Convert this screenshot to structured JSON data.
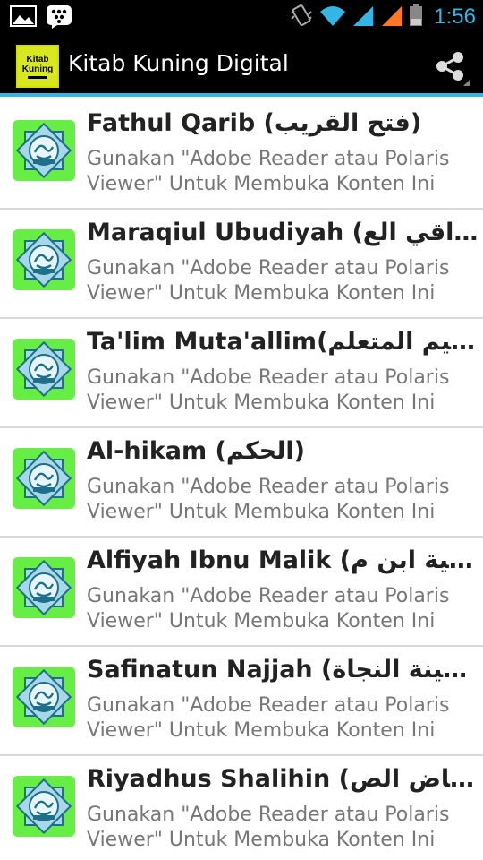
{
  "status_bar": {
    "time": "1:56",
    "icons": [
      "image-icon",
      "bbm-icon",
      "vibrate-icon",
      "wifi-icon",
      "signal-icon",
      "signal-icon",
      "battery-icon"
    ]
  },
  "action_bar": {
    "logo_line1": "Kitab",
    "logo_line2": "Kuning",
    "title": "Kitab Kuning Digital",
    "share_icon": "share-icon",
    "accent": "#33b5e5"
  },
  "list": {
    "subtitle": "Gunakan \"Adobe Reader atau Polaris Viewer\" Untuk Membuka Konten Ini",
    "icon_color": "#66ee44",
    "items": [
      {
        "title": "Fathul Qarib (فتح القريب)",
        "subtitle": "Gunakan \"Adobe Reader atau Polaris Viewer\" Untuk Membuka Konten Ini"
      },
      {
        "title": "Maraqiul Ubudiyah (مراقي الع...",
        "subtitle": "Gunakan \"Adobe Reader atau Polaris Viewer\" Untuk Membuka Konten Ini"
      },
      {
        "title": "Ta'lim Muta'allim(تعليم المتعلم)",
        "subtitle": "Gunakan \"Adobe Reader atau Polaris Viewer\" Untuk Membuka Konten Ini"
      },
      {
        "title": "Al-hikam (الحكم)",
        "subtitle": "Gunakan \"Adobe Reader atau Polaris Viewer\" Untuk Membuka Konten Ini"
      },
      {
        "title": "Alfiyah Ibnu Malik (الفية ابن م...",
        "subtitle": "Gunakan \"Adobe Reader atau Polaris Viewer\" Untuk Membuka Konten Ini"
      },
      {
        "title": "Safinatun Najjah (سفينة النجاة)",
        "subtitle": "Gunakan \"Adobe Reader atau Polaris Viewer\" Untuk Membuka Konten Ini"
      },
      {
        "title": "Riyadhus Shalihin (رياض الص...",
        "subtitle": "Gunakan \"Adobe Reader atau Polaris Viewer\" Untuk Membuka Konten Ini"
      }
    ]
  }
}
